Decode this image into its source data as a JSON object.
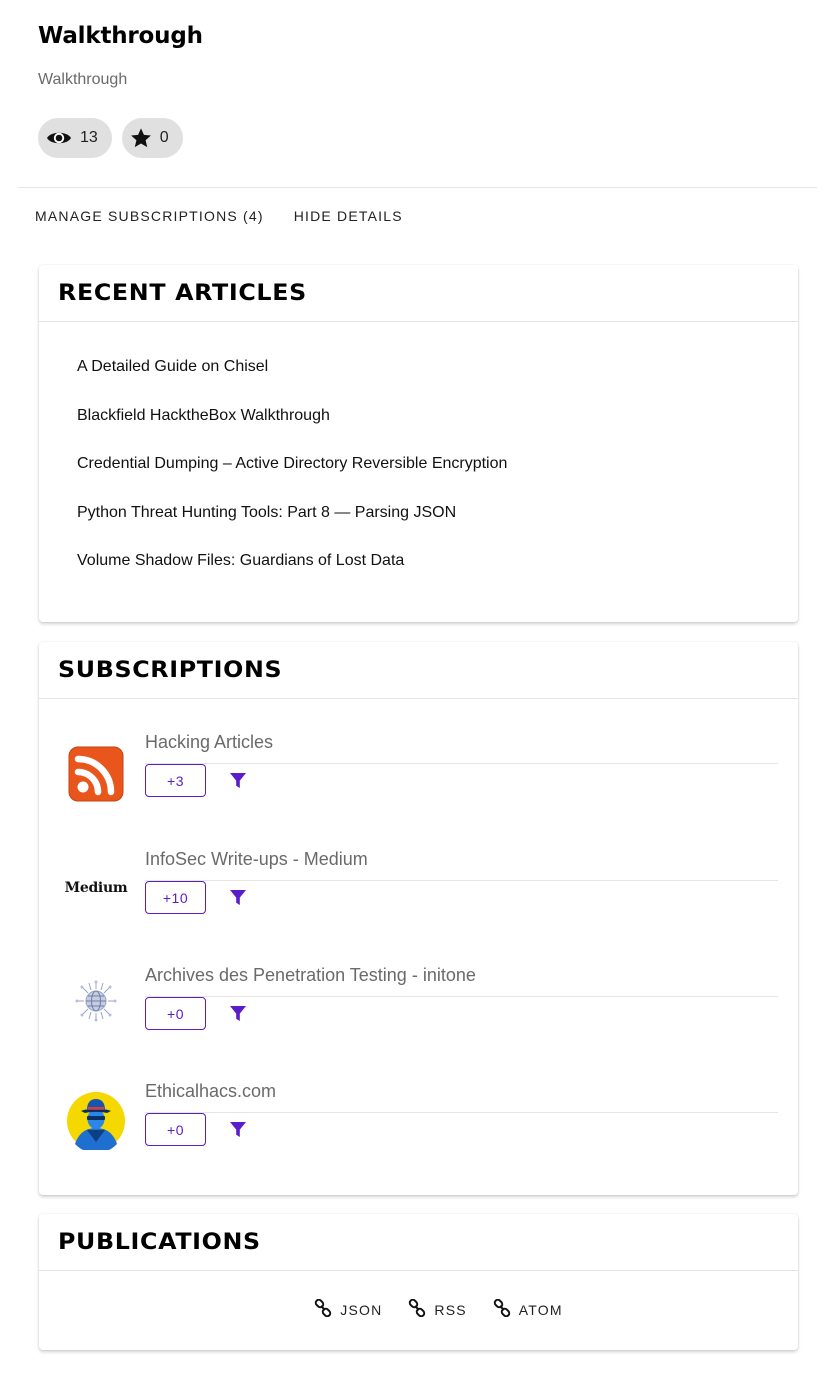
{
  "header": {
    "title": "Walkthrough",
    "subtitle": "Walkthrough"
  },
  "stats": {
    "views": "13",
    "stars": "0",
    "views_icon": "eye-icon",
    "stars_icon": "star-icon"
  },
  "actions": {
    "manage_label": "MANAGE SUBSCRIPTIONS (4)",
    "hide_label": "HIDE DETAILS"
  },
  "recent": {
    "title": "RECENT ARTICLES",
    "articles": [
      "A Detailed Guide on Chisel",
      "Blackfield HacktheBox Walkthrough",
      "Credential Dumping – Active Directory Reversible Encryption",
      "Python Threat Hunting Tools: Part 8 — Parsing JSON",
      "Volume Shadow Files: Guardians of Lost Data"
    ]
  },
  "subscriptions": {
    "title": "SUBSCRIPTIONS",
    "items": [
      {
        "name": "Hacking Articles",
        "count": "+3",
        "logo": "rss-logo"
      },
      {
        "name": "InfoSec Write-ups - Medium",
        "count": "+10",
        "logo": "medium-logo",
        "logo_text": "Medium"
      },
      {
        "name": "Archives des Penetration Testing - initone",
        "count": "+0",
        "logo": "globe-logo"
      },
      {
        "name": "Ethicalhacs.com",
        "count": "+0",
        "logo": "hacker-avatar-logo"
      }
    ],
    "filter_icon": "filter-icon"
  },
  "publications": {
    "title": "PUBLICATIONS",
    "links": [
      "JSON",
      "RSS",
      "ATOM"
    ],
    "link_icon": "link-icon"
  },
  "colors": {
    "accent": "#5b1cc9",
    "chip_bg": "#e0e0e0",
    "rss_orange": "#e8561c",
    "avatar_yellow": "#f4d800",
    "avatar_blue": "#1e6fd0"
  }
}
